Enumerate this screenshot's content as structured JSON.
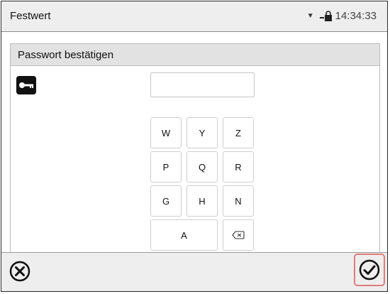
{
  "header": {
    "title": "Festwert",
    "time": "14:34:33"
  },
  "dialog": {
    "title": "Passwort bestätigen",
    "password_value": "",
    "keys": {
      "row1": [
        "W",
        "Y",
        "Z"
      ],
      "row2": [
        "P",
        "Q",
        "R"
      ],
      "row3": [
        "G",
        "H",
        "N"
      ],
      "row4": [
        "A"
      ]
    }
  },
  "icons": {
    "key": "key-icon",
    "lock": "lock-icon",
    "backspace": "backspace-icon",
    "cancel": "cancel-icon",
    "confirm": "checkmark-icon"
  },
  "colors": {
    "highlight": "#e07b7b"
  }
}
